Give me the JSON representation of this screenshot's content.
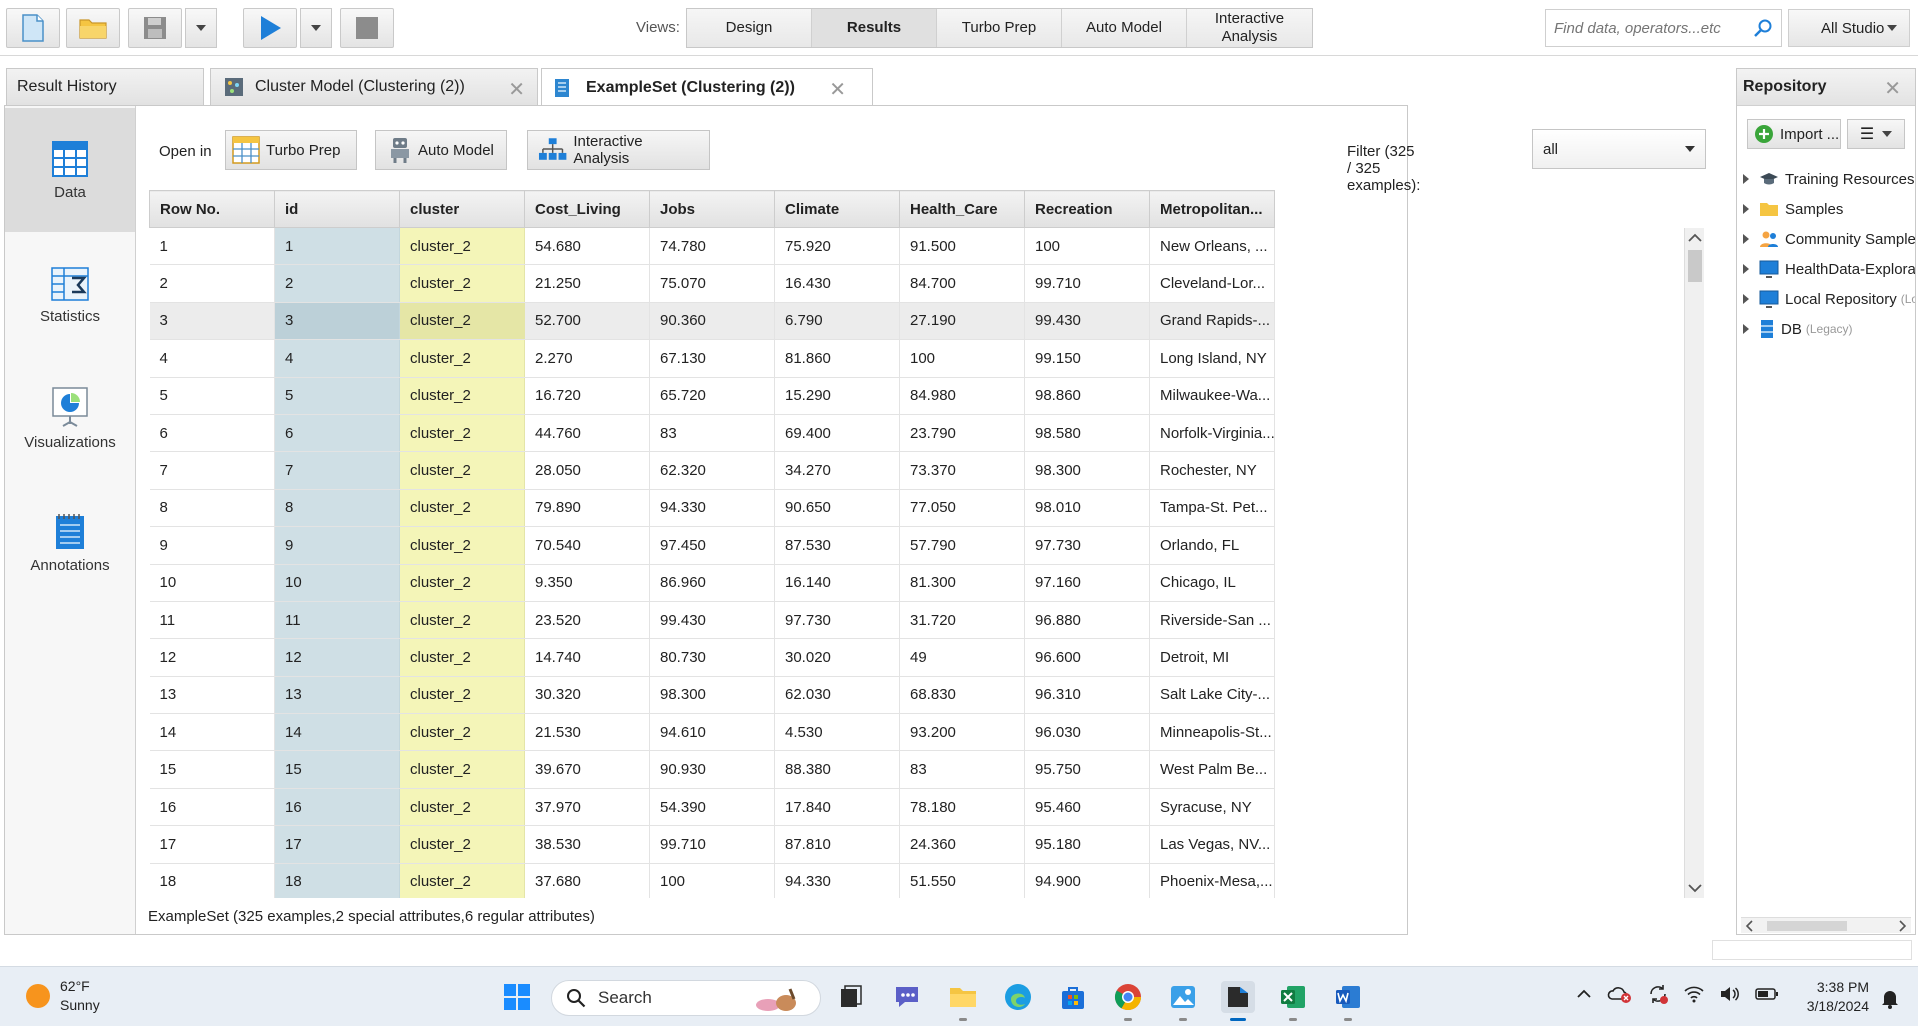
{
  "toolbar": {
    "views_label": "Views:",
    "views": [
      {
        "label": "Design",
        "active": false
      },
      {
        "label": "Results",
        "active": true
      },
      {
        "label": "Turbo Prep",
        "active": false
      },
      {
        "label": "Auto Model",
        "active": false
      },
      {
        "label": "Interactive Analysis",
        "active": false
      }
    ],
    "search_placeholder": "Find data, operators...etc",
    "studio_select": "All Studio"
  },
  "tabs": [
    {
      "label": "Result History",
      "active": false,
      "closable": false
    },
    {
      "label": "Cluster Model (Clustering (2))",
      "active": false,
      "closable": true
    },
    {
      "label": "ExampleSet (Clustering (2))",
      "active": true,
      "closable": true
    }
  ],
  "side_nav": [
    {
      "label": "Data",
      "icon": "data-table-icon",
      "active": true
    },
    {
      "label": "Statistics",
      "icon": "statistics-sigma-icon",
      "active": false
    },
    {
      "label": "Visualizations",
      "icon": "visualization-chart-icon",
      "active": false
    },
    {
      "label": "Annotations",
      "icon": "annotations-notepad-icon",
      "active": false
    }
  ],
  "open_in": {
    "label": "Open in",
    "buttons": [
      "Turbo Prep",
      "Auto Model",
      "Interactive Analysis"
    ]
  },
  "filter": {
    "label": "Filter (325 / 325 examples):",
    "value": "all"
  },
  "table": {
    "columns": [
      "Row No.",
      "id",
      "cluster",
      "Cost_Living",
      "Jobs",
      "Climate",
      "Health_Care",
      "Recreation",
      "Metropolitan..."
    ],
    "selected_row": 3,
    "rows": [
      [
        "1",
        "1",
        "cluster_2",
        "54.680",
        "74.780",
        "75.920",
        "91.500",
        "100",
        "New Orleans, ..."
      ],
      [
        "2",
        "2",
        "cluster_2",
        "21.250",
        "75.070",
        "16.430",
        "84.700",
        "99.710",
        "Cleveland-Lor..."
      ],
      [
        "3",
        "3",
        "cluster_2",
        "52.700",
        "90.360",
        "6.790",
        "27.190",
        "99.430",
        "Grand Rapids-..."
      ],
      [
        "4",
        "4",
        "cluster_2",
        "2.270",
        "67.130",
        "81.860",
        "100",
        "99.150",
        "Long Island, NY"
      ],
      [
        "5",
        "5",
        "cluster_2",
        "16.720",
        "65.720",
        "15.290",
        "84.980",
        "98.860",
        "Milwaukee-Wa..."
      ],
      [
        "6",
        "6",
        "cluster_2",
        "44.760",
        "83",
        "69.400",
        "23.790",
        "98.580",
        "Norfolk-Virginia..."
      ],
      [
        "7",
        "7",
        "cluster_2",
        "28.050",
        "62.320",
        "34.270",
        "73.370",
        "98.300",
        "Rochester, NY"
      ],
      [
        "8",
        "8",
        "cluster_2",
        "79.890",
        "94.330",
        "90.650",
        "77.050",
        "98.010",
        "Tampa-St. Pet..."
      ],
      [
        "9",
        "9",
        "cluster_2",
        "70.540",
        "97.450",
        "87.530",
        "57.790",
        "97.730",
        "Orlando, FL"
      ],
      [
        "10",
        "10",
        "cluster_2",
        "9.350",
        "86.960",
        "16.140",
        "81.300",
        "97.160",
        "Chicago, IL"
      ],
      [
        "11",
        "11",
        "cluster_2",
        "23.520",
        "99.430",
        "97.730",
        "31.720",
        "96.880",
        "Riverside-San ..."
      ],
      [
        "12",
        "12",
        "cluster_2",
        "14.740",
        "80.730",
        "30.020",
        "49",
        "96.600",
        "Detroit, MI"
      ],
      [
        "13",
        "13",
        "cluster_2",
        "30.320",
        "98.300",
        "62.030",
        "68.830",
        "96.310",
        "Salt Lake City-..."
      ],
      [
        "14",
        "14",
        "cluster_2",
        "21.530",
        "94.610",
        "4.530",
        "93.200",
        "96.030",
        "Minneapolis-St..."
      ],
      [
        "15",
        "15",
        "cluster_2",
        "39.670",
        "90.930",
        "88.380",
        "83",
        "95.750",
        "West Palm Be..."
      ],
      [
        "16",
        "16",
        "cluster_2",
        "37.970",
        "54.390",
        "17.840",
        "78.180",
        "95.460",
        "Syracuse, NY"
      ],
      [
        "17",
        "17",
        "cluster_2",
        "38.530",
        "99.710",
        "87.810",
        "24.360",
        "95.180",
        "Las Vegas, NV..."
      ],
      [
        "18",
        "18",
        "cluster_2",
        "37.680",
        "100",
        "94.330",
        "51.550",
        "94.900",
        "Phoenix-Mesa,..."
      ]
    ]
  },
  "status": "ExampleSet (325 examples,2 special attributes,6 regular attributes)",
  "repository": {
    "title": "Repository",
    "import_label": "Import ...",
    "items": [
      {
        "label": "Training Resources",
        "sub": "",
        "icon": "graduation-cap-icon"
      },
      {
        "label": "Samples",
        "sub": "",
        "icon": "folder-icon"
      },
      {
        "label": "Community Samples",
        "sub": "",
        "icon": "community-icon"
      },
      {
        "label": "HealthData-Explorat",
        "sub": "",
        "icon": "monitor-repo-icon"
      },
      {
        "label": "Local Repository",
        "sub": "(Lo",
        "icon": "monitor-repo-icon"
      },
      {
        "label": "DB",
        "sub": "(Legacy)",
        "icon": "database-icon"
      }
    ]
  },
  "taskbar": {
    "temperature": "62°F",
    "condition": "Sunny",
    "search_label": "Search",
    "time": "3:38 PM",
    "date": "3/18/2024"
  },
  "colors": {
    "id_column": "#cfdfe5",
    "cluster_column": "#f4f5b8",
    "accent_blue": "#1e7fd8"
  }
}
